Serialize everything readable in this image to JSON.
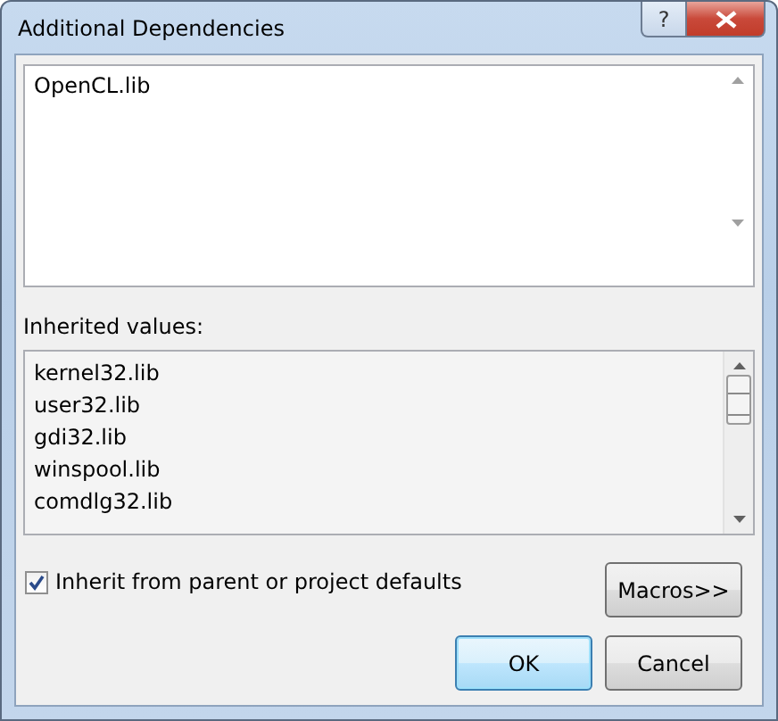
{
  "window": {
    "title": "Additional Dependencies",
    "help_button": "?"
  },
  "editor": {
    "lines": [
      "OpenCL.lib"
    ]
  },
  "inherited": {
    "label": "Inherited values:",
    "items": [
      "kernel32.lib",
      "user32.lib",
      "gdi32.lib",
      "winspool.lib",
      "comdlg32.lib"
    ]
  },
  "inherit_checkbox": {
    "label": "Inherit from parent or project defaults",
    "checked": true
  },
  "buttons": [
    {
      "label": "Macros>>",
      "default": false
    },
    {
      "label": "OK",
      "default": true
    },
    {
      "label": "Cancel",
      "default": false
    }
  ]
}
